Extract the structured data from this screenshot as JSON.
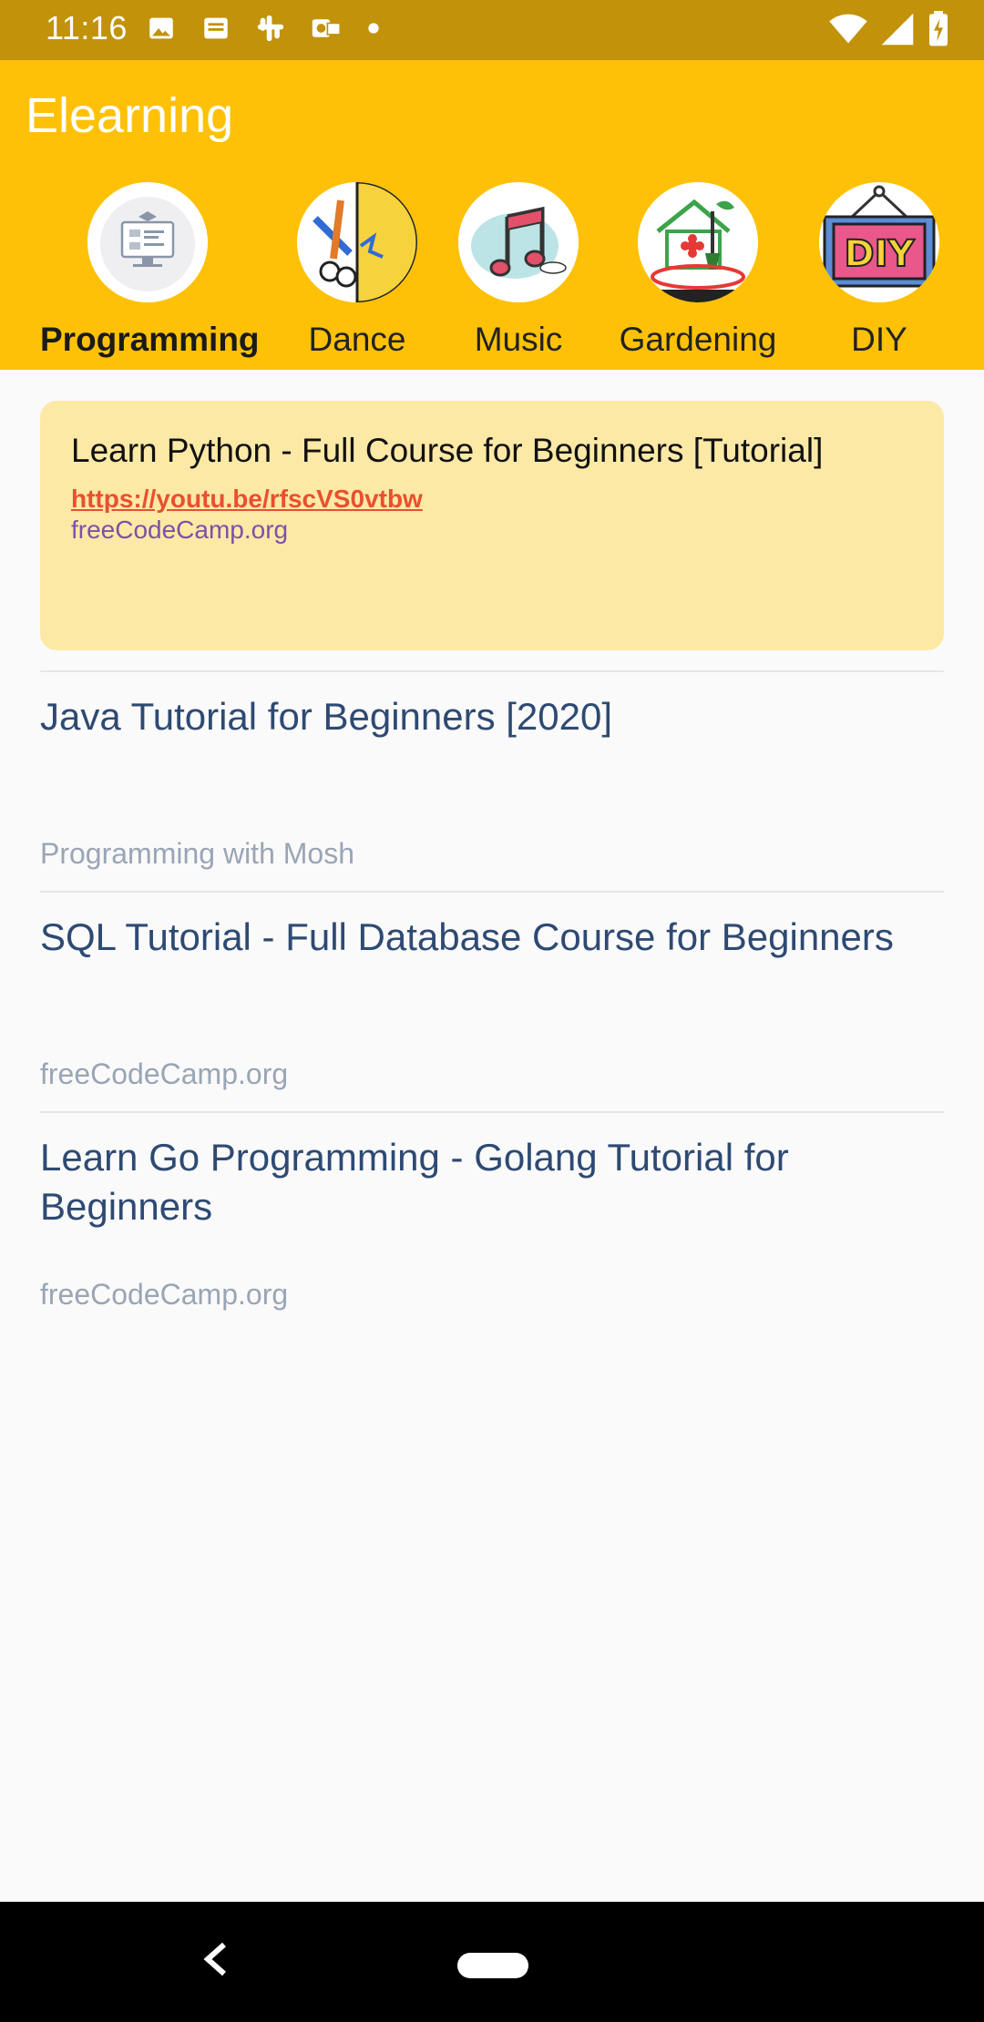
{
  "status": {
    "time": "11:16"
  },
  "app": {
    "title": "Elearning"
  },
  "categories": [
    {
      "label": "Programming",
      "icon": "computer-icon",
      "selected": true
    },
    {
      "label": "Dance",
      "icon": "dance-icon",
      "selected": false
    },
    {
      "label": "Music",
      "icon": "music-note-icon",
      "selected": false
    },
    {
      "label": "Gardening",
      "icon": "gardening-icon",
      "selected": false
    },
    {
      "label": "DIY",
      "icon": "diy-sign-icon",
      "selected": false
    }
  ],
  "featured": {
    "title": "Learn Python - Full Course for Beginners [Tutorial]",
    "link": "https://youtu.be/rfscVS0vtbw",
    "channel": "freeCodeCamp.org"
  },
  "videos": [
    {
      "title": "Java Tutorial for Beginners [2020]",
      "channel": "Programming with Mosh"
    },
    {
      "title": "SQL Tutorial - Full Database Course for Beginners",
      "channel": "freeCodeCamp.org"
    },
    {
      "title": "Learn Go Programming - Golang Tutorial for Beginners",
      "channel": "freeCodeCamp.org"
    }
  ],
  "colors": {
    "status_bar": "#C1920A",
    "app_bar": "#FFC107",
    "card": "#FDE9A6",
    "link": "#E8502F",
    "title_text": "#2E4A73"
  }
}
